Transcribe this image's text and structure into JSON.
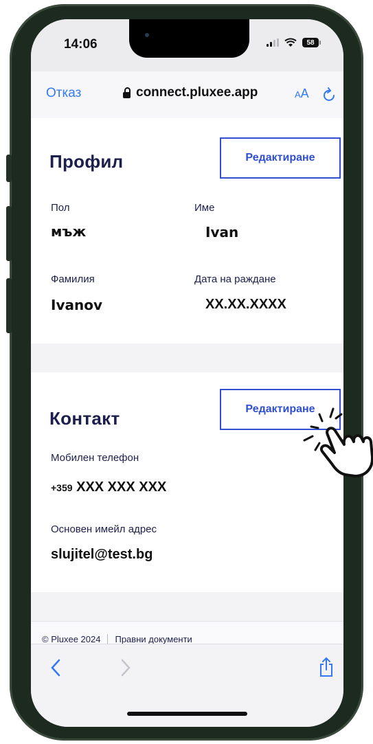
{
  "status": {
    "time": "14:06",
    "battery": "58"
  },
  "browser": {
    "cancel_label": "Отказ",
    "url": "connect.pluxee.app",
    "text_size_label_small": "A",
    "text_size_label_large": "A"
  },
  "profile": {
    "title": "Профил",
    "edit_label": "Редактиране",
    "gender_label": "Пол",
    "gender_value": "мъж",
    "first_name_label": "Име",
    "first_name_value": "Ivan",
    "last_name_label": "Фамилия",
    "last_name_value": "Ivanov",
    "birth_date_label": "Дата на раждане",
    "birth_date_value": "XX.XX.XXXX"
  },
  "contact": {
    "title": "Контакт",
    "edit_label": "Редактиране",
    "phone_label": "Мобилен телефон",
    "phone_prefix": "+359",
    "phone_value": "XXX XXX XXX",
    "email_label": "Основен имейл адрес",
    "email_value": "slujitel@test.bg"
  },
  "footer": {
    "copyright": "© Pluxee 2024",
    "legal_link": "Правни документи"
  },
  "icons": {
    "back": "chevron-left-icon",
    "forward": "chevron-right-icon",
    "share": "share-icon",
    "reload": "reload-icon",
    "lock": "lock-icon",
    "pointer": "tap-hand-icon"
  },
  "colors": {
    "accent": "#2f4fd0",
    "heading": "#1c1f4c",
    "link": "#3478f6",
    "frame": "#1d2a1f"
  }
}
